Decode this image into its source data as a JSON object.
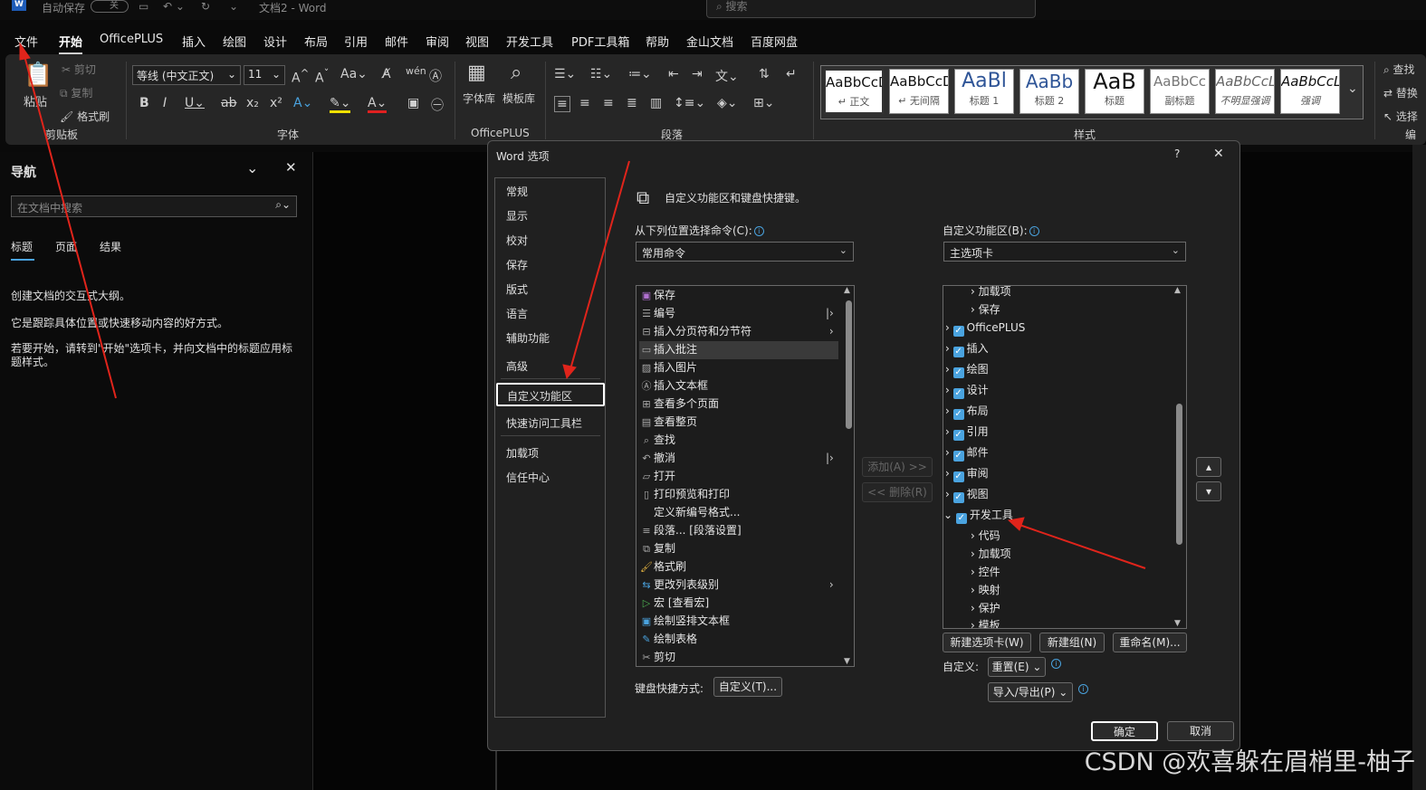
{
  "titlebar": {
    "autosave_label": "自动保存",
    "autosave_state": "关",
    "doc_title": "文档2 - Word",
    "search_placeholder": "搜索"
  },
  "menu": [
    "文件",
    "开始",
    "OfficePLUS",
    "插入",
    "绘图",
    "设计",
    "布局",
    "引用",
    "邮件",
    "审阅",
    "视图",
    "开发工具",
    "PDF工具箱",
    "帮助",
    "金山文档",
    "百度网盘"
  ],
  "ribbon": {
    "clipboard": {
      "paste": "粘贴",
      "cut": "剪切",
      "copy": "复制",
      "format_painter": "格式刷",
      "label": "剪贴板"
    },
    "font": {
      "font_name": "等线 (中文正文)",
      "font_size": "11",
      "label": "字体"
    },
    "officeplus": {
      "font_lib": "字体库",
      "template_lib": "模板库",
      "label": "OfficePLUS"
    },
    "paragraph": {
      "label": "段落"
    },
    "styles": {
      "label": "样式",
      "items": [
        {
          "preview": "AaBbCcD",
          "name": "↵ 正文"
        },
        {
          "preview": "AaBbCcD",
          "name": "↵ 无间隔"
        },
        {
          "preview": "AaBl",
          "name": "标题 1"
        },
        {
          "preview": "AaBb",
          "name": "标题 2"
        },
        {
          "preview": "AaB",
          "name": "标题"
        },
        {
          "preview": "AaBbCc",
          "name": "副标题"
        },
        {
          "preview": "AaBbCcL",
          "name": "不明显强调"
        },
        {
          "preview": "AaBbCcL",
          "name": "强调"
        }
      ]
    },
    "editing": {
      "find": "查找",
      "replace": "替换",
      "select": "选择",
      "label": "编"
    }
  },
  "nav": {
    "title": "导航",
    "search_placeholder": "在文档中搜索",
    "tabs": [
      "标题",
      "页面",
      "结果"
    ],
    "text1": "创建文档的交互式大纲。",
    "text2": "它是跟踪具体位置或快速移动内容的好方式。",
    "text3": "若要开始，请转到\"开始\"选项卡，并向文档中的标题应用标题样式。"
  },
  "dialog": {
    "title": "Word 选项",
    "help": "?",
    "close": "✕",
    "categories": [
      "常规",
      "显示",
      "校对",
      "保存",
      "版式",
      "语言",
      "辅助功能",
      "高级",
      "自定义功能区",
      "快速访问工具栏",
      "加载项",
      "信任中心"
    ],
    "header": "自定义功能区和键盘快捷键。",
    "choose_label": "从下列位置选择命令(C):",
    "choose_value": "常用命令",
    "customize_label": "自定义功能区(B):",
    "customize_value": "主选项卡",
    "commands": [
      "保存",
      "编号",
      "插入分页符和分节符",
      "插入批注",
      "插入图片",
      "插入文本框",
      "查看多个页面",
      "查看整页",
      "查找",
      "撤消",
      "打开",
      "打印预览和打印",
      "定义新编号格式...",
      "段落... [段落设置]",
      "复制",
      "格式刷",
      "更改列表级别",
      "宏 [查看宏]",
      "绘制竖排文本框",
      "绘制表格",
      "剪切"
    ],
    "tree": [
      {
        "label": "加载项",
        "level": 2
      },
      {
        "label": "保存",
        "level": 2
      },
      {
        "label": "OfficePLUS",
        "level": 1
      },
      {
        "label": "插入",
        "level": 1
      },
      {
        "label": "绘图",
        "level": 1
      },
      {
        "label": "设计",
        "level": 1
      },
      {
        "label": "布局",
        "level": 1
      },
      {
        "label": "引用",
        "level": 1
      },
      {
        "label": "邮件",
        "level": 1
      },
      {
        "label": "审阅",
        "level": 1
      },
      {
        "label": "视图",
        "level": 1
      },
      {
        "label": "开发工具",
        "level": 1
      },
      {
        "label": "代码",
        "level": 2
      },
      {
        "label": "加载项",
        "level": 2
      },
      {
        "label": "控件",
        "level": 2
      },
      {
        "label": "映射",
        "level": 2
      },
      {
        "label": "保护",
        "level": 2
      },
      {
        "label": "模板",
        "level": 2
      }
    ],
    "add_button": "添加(A) >>",
    "remove_button": "<< 删除(R)",
    "new_tab": "新建选项卡(W)",
    "new_group": "新建组(N)",
    "rename": "重命名(M)...",
    "customize_label2": "自定义:",
    "reset": "重置(E)",
    "import_export": "导入/导出(P)",
    "keyboard_label": "键盘快捷方式:",
    "keyboard_button": "自定义(T)...",
    "ok": "确定",
    "cancel": "取消"
  },
  "watermark": "CSDN @欢喜躲在眉梢里-柚子",
  "colors": {
    "accent": "#4aa3df",
    "annotation_arrow": "#e0241b"
  }
}
